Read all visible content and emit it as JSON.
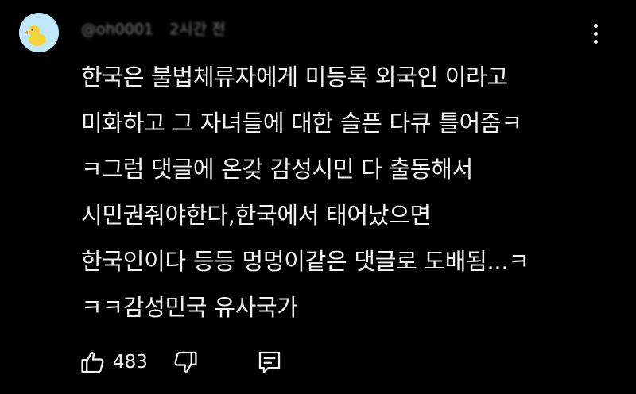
{
  "comment": {
    "author": "@oh0001",
    "time_ago": "2시간 전",
    "lines": [
      "한국은 불법체류자에게 미등록 외국인 이라고",
      "미화하고 그 자녀들에 대한 슬픈 다큐 틀어줌ㅋ",
      "ㅋ그럼 댓글에 온갖 감성시민 다 출동해서",
      "시민권줘야한다,한국에서 태어났으면",
      "한국인이다 등등 멍멍이같은 댓글로 도배됨...ㅋ",
      "ㅋㅋ감성민국 유사국가"
    ],
    "like_count": "483"
  },
  "icons": {
    "avatar": "duck-avatar-icon",
    "menu": "more-vert-icon",
    "like": "thumbs-up-icon",
    "dislike": "thumbs-down-icon",
    "reply": "reply-comment-icon"
  },
  "colors": {
    "background": "#000000",
    "text": "#f1f1f1",
    "secondary_text": "#9c9c9c",
    "avatar_bg": "#bfe6fb",
    "avatar_duck": "#f5d33b"
  }
}
